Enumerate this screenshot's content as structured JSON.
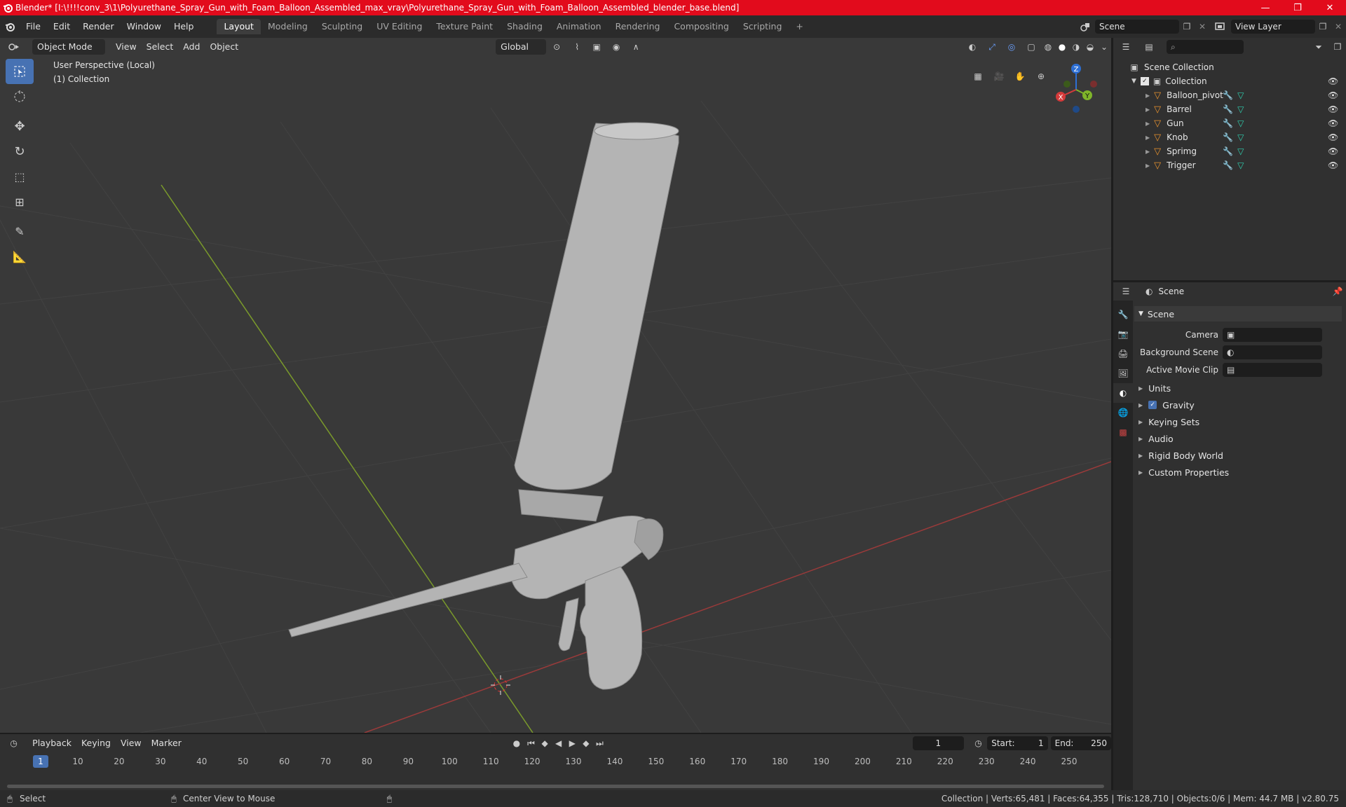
{
  "window": {
    "title": "Blender* [I:\\!!!!conv_3\\1\\Polyurethane_Spray_Gun_with_Foam_Balloon_Assembled_max_vray\\Polyurethane_Spray_Gun_with_Foam_Balloon_Assembled_blender_base.blend]",
    "accent": "#e20b1c",
    "controls": [
      "—",
      "❐",
      "✕"
    ]
  },
  "menu": [
    "File",
    "Edit",
    "Render",
    "Window",
    "Help"
  ],
  "workspaces": [
    "Layout",
    "Modeling",
    "Sculpting",
    "UV Editing",
    "Texture Paint",
    "Shading",
    "Animation",
    "Rendering",
    "Compositing",
    "Scripting"
  ],
  "workspace_add": "+",
  "scene_field": "Scene",
  "view_layer_field": "View Layer",
  "viewport": {
    "mode": "Object Mode",
    "menus": [
      "View",
      "Select",
      "Add",
      "Object"
    ],
    "transform_orientation": "Global",
    "overlay_line1": "User Perspective (Local)",
    "overlay_line2": "(1) Collection",
    "gizmo": {
      "x": "X",
      "y": "Y",
      "z": "Z"
    }
  },
  "outliner": {
    "root": "Scene Collection",
    "collection": "Collection",
    "objects": [
      "Balloon_pivot",
      "Barrel",
      "Gun",
      "Knob",
      "Sprimg",
      "Trigger"
    ]
  },
  "properties": {
    "header": "Scene",
    "panel": "Scene",
    "fields": [
      {
        "label": "Camera"
      },
      {
        "label": "Background Scene"
      },
      {
        "label": "Active Movie Clip"
      }
    ],
    "subpanels": [
      "Units",
      "Gravity",
      "Keying Sets",
      "Audio",
      "Rigid Body World",
      "Custom Properties"
    ],
    "gravity_checked": true
  },
  "timeline": {
    "menus": [
      "Playback",
      "Keying",
      "View",
      "Marker"
    ],
    "current_frame": "1",
    "start_label": "Start:",
    "start": "1",
    "end_label": "End:",
    "end": "250",
    "ruler": [
      "10",
      "20",
      "30",
      "40",
      "50",
      "60",
      "70",
      "80",
      "90",
      "100",
      "110",
      "120",
      "130",
      "140",
      "150",
      "160",
      "170",
      "180",
      "190",
      "200",
      "210",
      "220",
      "230",
      "240",
      "250"
    ],
    "playhead": "1"
  },
  "status": {
    "left": "Select",
    "middle": "Center View to Mouse",
    "right": "Collection | Verts:65,481 | Faces:64,355 | Tris:128,710 | Objects:0/6 | Mem: 44.7 MB | v2.80.75"
  }
}
